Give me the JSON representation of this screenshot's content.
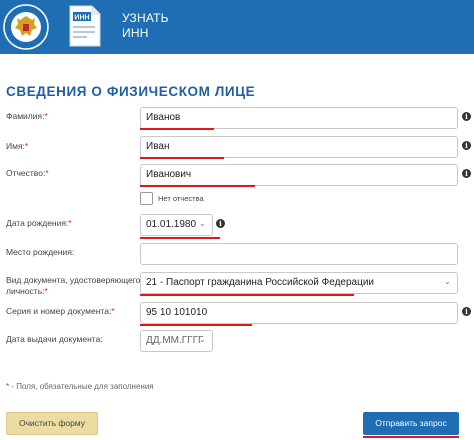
{
  "header": {
    "title_line1": "УЗНАТЬ",
    "title_line2": "ИНН",
    "doc_icon_text": "ИНН"
  },
  "form": {
    "section_title": "СВЕДЕНИЯ О ФИЗИЧЕСКОМ ЛИЦЕ",
    "required_mark": "*",
    "surname": {
      "label": "Фамилия:",
      "value": "Иванов",
      "required": true
    },
    "name": {
      "label": "Имя:",
      "value": "Иван",
      "required": true
    },
    "patronymic": {
      "label": "Отчество:",
      "value": "Иванович",
      "required": true
    },
    "no_patronymic_label": "Нет отчества",
    "birth_date": {
      "label": "Дата рождения:",
      "value": "01.01.1980",
      "required": true
    },
    "birth_place": {
      "label": "Место рождения:",
      "value": ""
    },
    "doc_type": {
      "label_line1": "Вид документа, удостоверяющего",
      "label_line2": "личность:",
      "value": "21 - Паспорт гражданина Российской Федерации",
      "required": true
    },
    "doc_number": {
      "label": "Серия и номер документа:",
      "value": "95 10 101010",
      "required": true
    },
    "issue_date": {
      "label": "Дата выдачи документа:",
      "placeholder": "ДД.ММ.ГГГГ"
    },
    "required_note": "* - Поля, обязательные для заполнения",
    "info_glyph": "i"
  },
  "buttons": {
    "clear": "Очистить форму",
    "submit": "Отправить запрос"
  },
  "colors": {
    "header_bg": "#1f6db3",
    "title_blue": "#1f5fa6",
    "required_red": "#e02020",
    "highlight_underline": "#e01818",
    "clear_btn_bg": "#ecdca2",
    "submit_btn_bg": "#1f6db3"
  }
}
